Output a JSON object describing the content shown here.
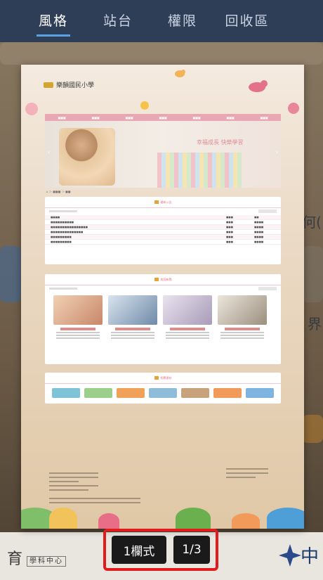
{
  "tabs": [
    {
      "label": "風格",
      "active": true
    },
    {
      "label": "站台",
      "active": false
    },
    {
      "label": "權限",
      "active": false
    },
    {
      "label": "回收區",
      "active": false
    }
  ],
  "colors": {
    "tabbar_bg": "#2f3e57",
    "tab_underline": "#5aa2e6",
    "highlight_border": "#e21c1c",
    "pill_bg": "#1a1a1a"
  },
  "preview": {
    "school_name": "樂韻國民小學",
    "banner_slogan": "幸福成長 快樂學習",
    "sections": [
      "最新公告",
      "校園新聞",
      "相關連結"
    ]
  },
  "background_fragments": {
    "bottom_left_logo_text": "育",
    "bottom_left_badge": "學科中心",
    "bottom_right_char": "中",
    "right_edge_text_1": "何(",
    "right_edge_text_2": "界"
  },
  "controls": {
    "layout_label": "1欄式",
    "page_indicator": "1/3"
  }
}
